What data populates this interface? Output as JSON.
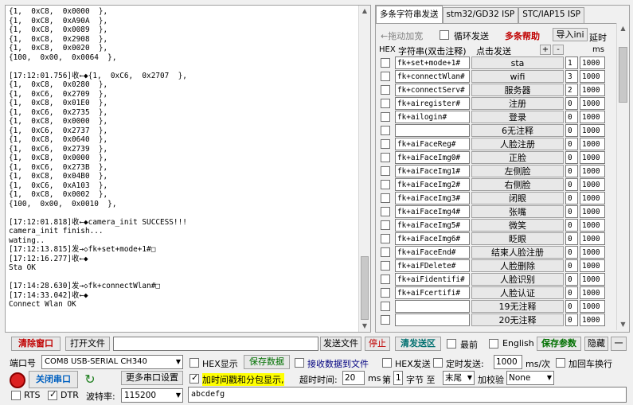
{
  "log": {
    "lines": [
      "{1,  0xC8,  0x0000  },",
      "{1,  0xC8,  0xA90A  },",
      "{1,  0xC8,  0x0089  },",
      "{1,  0xC8,  0x2908  },",
      "{1,  0xC8,  0x0020  },",
      "{100,  0x00,  0x0064  },",
      "",
      "[17:12:01.756]收←◆{1,  0xC6,  0x2707  },",
      "{1,  0xC8,  0x0280  },",
      "{1,  0xC6,  0x2709  },",
      "{1,  0xC8,  0x01E0  },",
      "{1,  0xC6,  0x2735  },",
      "{1,  0xC8,  0x0000  },",
      "{1,  0xC6,  0x2737  },",
      "{1,  0xC8,  0x0640  },",
      "{1,  0xC6,  0x2739  },",
      "{1,  0xC8,  0x0000  },",
      "{1,  0xC6,  0x273B  },",
      "{1,  0xC8,  0x04B0  },",
      "{1,  0xC6,  0xA103  },",
      "{1,  0xC8,  0x0002  },",
      "{100,  0x00,  0x0010  },",
      "",
      "[17:12:01.818]收←◆camera_init SUCCESS!!!",
      "camera_init finish...",
      "wating..",
      "[17:12:13.815]发→◇fk+set+mode+1#□",
      "[17:12:16.277]收←◆",
      "Sta OK",
      "",
      "[17:14:28.630]发→◇fk+connectWlan#□",
      "[17:14:33.042]收←◆",
      "Connect Wlan OK"
    ]
  },
  "tabs": [
    "多条字符串发送",
    "stm32/GD32 ISP",
    "STC/IAP15 ISP"
  ],
  "panel_top": {
    "drag_label": "←拖动加宽",
    "loop_label": "循环发送",
    "help_label": "多条帮助",
    "import_label": "导入ini",
    "hex_header": "HEX",
    "string_header": "字符串(双击注释)",
    "click_send_header": "点击发送",
    "plus": "+",
    "minus": "-",
    "delay_header": "延时",
    "ms_header": "ms"
  },
  "rows": [
    {
      "cmd": "fk+set+mode+1#",
      "label": "sta",
      "order": "1",
      "delay": "1000"
    },
    {
      "cmd": "fk+connectWlan#",
      "label": "wifi",
      "order": "3",
      "delay": "1000"
    },
    {
      "cmd": "fk+connectServ#",
      "label": "服务器",
      "order": "2",
      "delay": "1000"
    },
    {
      "cmd": "fk+airegister#",
      "label": "注册",
      "order": "0",
      "delay": "1000"
    },
    {
      "cmd": "fk+ailogin#",
      "label": "登录",
      "order": "0",
      "delay": "1000"
    },
    {
      "cmd": "",
      "label": "6无注释",
      "order": "0",
      "delay": "1000"
    },
    {
      "cmd": "fk+aiFaceReg#",
      "label": "人脸注册",
      "order": "0",
      "delay": "1000"
    },
    {
      "cmd": "fk+aiFaceImg0#",
      "label": "正脸",
      "order": "0",
      "delay": "1000"
    },
    {
      "cmd": "fk+aiFaceImg1#",
      "label": "左侧脸",
      "order": "0",
      "delay": "1000"
    },
    {
      "cmd": "fk+aiFaceImg2#",
      "label": "右侧脸",
      "order": "0",
      "delay": "1000"
    },
    {
      "cmd": "fk+aiFaceImg3#",
      "label": "闭眼",
      "order": "0",
      "delay": "1000"
    },
    {
      "cmd": "fk+aiFaceImg4#",
      "label": "张嘴",
      "order": "0",
      "delay": "1000"
    },
    {
      "cmd": "fk+aiFaceImg5#",
      "label": "微笑",
      "order": "0",
      "delay": "1000"
    },
    {
      "cmd": "fk+aiFaceImg6#",
      "label": "眨眼",
      "order": "0",
      "delay": "1000"
    },
    {
      "cmd": "fk+aiFaceEnd#",
      "label": "结束人脸注册",
      "order": "0",
      "delay": "1000"
    },
    {
      "cmd": "fk+aiFDelete#",
      "label": "人脸删除",
      "order": "0",
      "delay": "1000"
    },
    {
      "cmd": "fk+aiFidentifi#",
      "label": "人脸识别",
      "order": "0",
      "delay": "1000"
    },
    {
      "cmd": "fk+aiFcertifi#",
      "label": "人脸认证",
      "order": "0",
      "delay": "1000"
    },
    {
      "cmd": "",
      "label": "19无注释",
      "order": "0",
      "delay": "1000"
    },
    {
      "cmd": "",
      "label": "20无注释",
      "order": "0",
      "delay": "1000"
    }
  ],
  "toolbar": {
    "clear_window": "清除窗口",
    "open_file": "打开文件",
    "send_file": "发送文件",
    "stop": "停止",
    "clear_send": "清发送区",
    "topmost": "最前",
    "english": "English",
    "save_params": "保存参数",
    "hide": "隐藏",
    "expand": "一"
  },
  "bottom": {
    "port_label": "端口号",
    "port_value": "COM8 USB-SERIAL CH340",
    "close_port": "关闭串口",
    "more_settings": "更多串口设置",
    "rts": "RTS",
    "dtr": "DTR",
    "baud_label": "波特率:",
    "baud_value": "115200",
    "hex_display": "HEX显示",
    "save_data": "保存数据",
    "recv_to_file": "接收数据到文件",
    "hex_send": "HEX发送",
    "timed_send": "定时发送:",
    "timed_value": "1000",
    "timed_unit": "ms/次",
    "add_crlf": "加回车换行",
    "timestamp": "加时间戳和分包显示,",
    "timeout_label": "超时时间:",
    "timeout_value": "20",
    "timeout_unit": "ms",
    "nth_label": "第",
    "nth_value": "1",
    "byte_label": "字节 至",
    "end_value": "末尾",
    "checksum_label": "加校验",
    "checksum_value": "None",
    "send_text": "abcdefg"
  }
}
